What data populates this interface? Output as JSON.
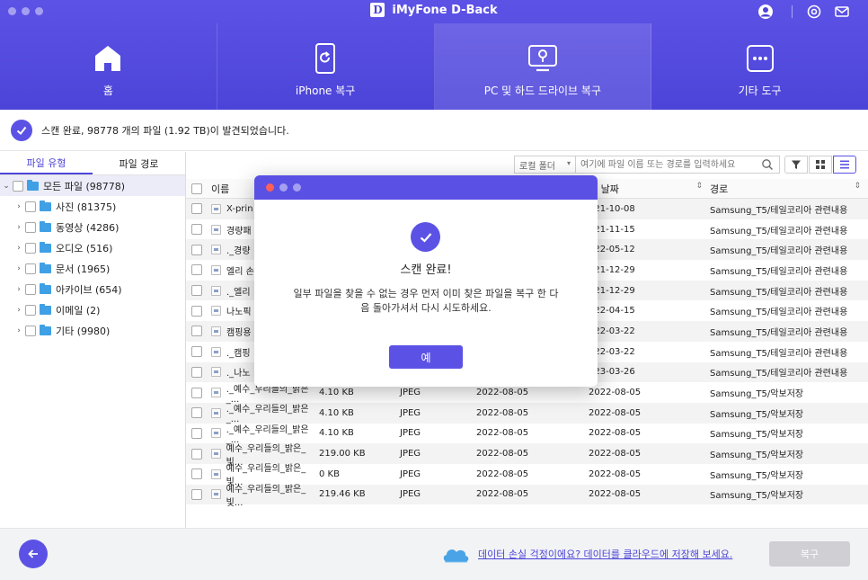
{
  "window": {
    "title": "iMyFone D-Back",
    "logo_letter": "D"
  },
  "nav": [
    {
      "label": "홈",
      "icon": "home-icon"
    },
    {
      "label": "iPhone 복구",
      "icon": "phone-refresh-icon"
    },
    {
      "label": "PC 및 하드 드라이브 복구",
      "icon": "monitor-icon"
    },
    {
      "label": "기타 도구",
      "icon": "more-tools-icon"
    }
  ],
  "status": {
    "text": "스캔 완료, 98778 개의 파일 (1.92 TB)이 발견되었습니다."
  },
  "sidebar": {
    "tabs": [
      "파일 유형",
      "파일 경로"
    ],
    "tree": [
      {
        "label": "모든 파일 (98778)"
      },
      {
        "label": "사진 (81375)"
      },
      {
        "label": "동영상 (4286)"
      },
      {
        "label": "오디오 (516)"
      },
      {
        "label": "문서 (1965)"
      },
      {
        "label": "아카이브 (654)"
      },
      {
        "label": "이메일 (2)"
      },
      {
        "label": "기타 (9980)"
      }
    ]
  },
  "toolbar": {
    "folder_select": "로컬 폴더",
    "search_placeholder": "여기에 파일 이름 또는 경로를 입력하세요"
  },
  "table": {
    "headers": {
      "name": "이름",
      "modified": "정 날짜",
      "path": "경로"
    },
    "rows": [
      {
        "name": "X-prin",
        "size": "",
        "type": "",
        "created": "",
        "modified": "021-10-08",
        "path": "Samsung_T5/테일코리아 관련내용"
      },
      {
        "name": "경량패",
        "size": "",
        "type": "",
        "created": "",
        "modified": "021-11-15",
        "path": "Samsung_T5/테일코리아 관련내용"
      },
      {
        "name": "._경량",
        "size": "",
        "type": "",
        "created": "",
        "modified": "022-05-12",
        "path": "Samsung_T5/테일코리아 관련내용"
      },
      {
        "name": "엘리 손",
        "size": "",
        "type": "",
        "created": "",
        "modified": "021-12-29",
        "path": "Samsung_T5/테일코리아 관련내용"
      },
      {
        "name": "._엘리",
        "size": "",
        "type": "",
        "created": "",
        "modified": "021-12-29",
        "path": "Samsung_T5/테일코리아 관련내용"
      },
      {
        "name": "나노픽",
        "size": "",
        "type": "",
        "created": "",
        "modified": "022-04-15",
        "path": "Samsung_T5/테일코리아 관련내용"
      },
      {
        "name": "캠핑용",
        "size": "",
        "type": "",
        "created": "",
        "modified": "022-03-22",
        "path": "Samsung_T5/테일코리아 관련내용"
      },
      {
        "name": "._캠핑",
        "size": "",
        "type": "",
        "created": "",
        "modified": "022-03-22",
        "path": "Samsung_T5/테일코리아 관련내용"
      },
      {
        "name": "._나노",
        "size": "",
        "type": "",
        "created": "",
        "modified": "023-03-26",
        "path": "Samsung_T5/테일코리아 관련내용"
      },
      {
        "name": "._예수_우리들의_밝은_...",
        "size": "4.10 KB",
        "type": "JPEG",
        "created": "2022-08-05",
        "modified": "2022-08-05",
        "path": "Samsung_T5/악보저장"
      },
      {
        "name": "._예수_우리들의_밝은_...",
        "size": "4.10 KB",
        "type": "JPEG",
        "created": "2022-08-05",
        "modified": "2022-08-05",
        "path": "Samsung_T5/악보저장"
      },
      {
        "name": "._예수_우리들의_밝은_...",
        "size": "4.10 KB",
        "type": "JPEG",
        "created": "2022-08-05",
        "modified": "2022-08-05",
        "path": "Samsung_T5/악보저장"
      },
      {
        "name": "예수_우리들의_밝은_빛...",
        "size": "219.00 KB",
        "type": "JPEG",
        "created": "2022-08-05",
        "modified": "2022-08-05",
        "path": "Samsung_T5/악보저장"
      },
      {
        "name": "예수_우리들의_밝은_빛...",
        "size": "0 KB",
        "type": "JPEG",
        "created": "2022-08-05",
        "modified": "2022-08-05",
        "path": "Samsung_T5/악보저장"
      },
      {
        "name": "예수_우리들의_밝은_빛...",
        "size": "219.46 KB",
        "type": "JPEG",
        "created": "2022-08-05",
        "modified": "2022-08-05",
        "path": "Samsung_T5/악보저장"
      }
    ]
  },
  "footer": {
    "cloud_link": "데이터 손실 걱정이에요? 데이터를 클라우드에 저장해 보세요.",
    "recover_label": "복구"
  },
  "dialog": {
    "title": "스캔 완료!",
    "message": "일부 파일을 찾을 수 없는 경우 먼저 이미 찾은 파일을 복구 한 다음 돌아가셔서 다시 시도하세요.",
    "ok_label": "예"
  },
  "colors": {
    "accent": "#5b52e5",
    "header": "#4c44d8",
    "link": "#4c44d8",
    "folder": "#3fa0e6",
    "disabled_button": "#cfcfd4"
  }
}
